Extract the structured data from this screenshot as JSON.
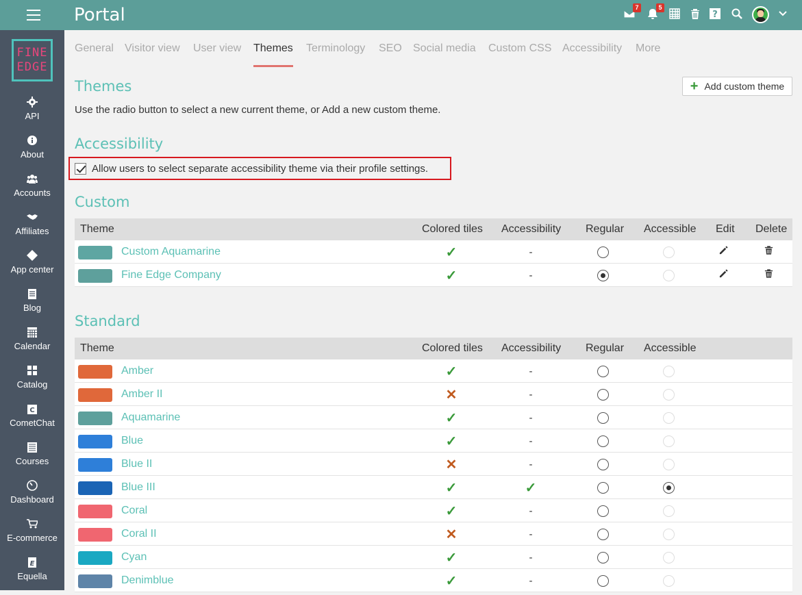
{
  "app": {
    "title": "Portal"
  },
  "topbar": {
    "mail_badge": "7",
    "notifications_badge": "5",
    "icons": [
      "hamburger-icon",
      "mail-icon",
      "bell-icon",
      "calendar-grid-icon",
      "trash-icon",
      "help-icon",
      "search-icon",
      "avatar",
      "chevron-down-icon"
    ]
  },
  "sidebar": {
    "logo_top": "FINE",
    "logo_bottom": "EDGE",
    "items": [
      {
        "label": "API",
        "icon": "gear-icon"
      },
      {
        "label": "About",
        "icon": "info-icon"
      },
      {
        "label": "Accounts",
        "icon": "users-icon"
      },
      {
        "label": "Affiliates",
        "icon": "handshake-icon"
      },
      {
        "label": "App center",
        "icon": "diamonds-icon"
      },
      {
        "label": "Blog",
        "icon": "document-icon"
      },
      {
        "label": "Calendar",
        "icon": "calendar-icon"
      },
      {
        "label": "Catalog",
        "icon": "grid-icon"
      },
      {
        "label": "CometChat",
        "icon": "cometchat-icon"
      },
      {
        "label": "Courses",
        "icon": "courses-icon"
      },
      {
        "label": "Dashboard",
        "icon": "dashboard-icon"
      },
      {
        "label": "E-commerce",
        "icon": "cart-icon"
      },
      {
        "label": "Equella",
        "icon": "equella-icon"
      }
    ]
  },
  "tabs": [
    "General",
    "Visitor view",
    "User view",
    "Themes",
    "Terminology",
    "SEO",
    "Social media",
    "Custom CSS",
    "Accessibility",
    "More"
  ],
  "active_tab": "Themes",
  "themes_section": {
    "title": "Themes",
    "description": "Use the radio button to select a new current theme, or Add a new custom theme.",
    "add_button": "Add custom theme"
  },
  "accessibility_section": {
    "title": "Accessibility",
    "checkbox_label": "Allow users to select separate accessibility theme via their profile settings.",
    "checked": true
  },
  "custom_section": {
    "title": "Custom",
    "headers": {
      "theme": "Theme",
      "tiles": "Colored tiles",
      "accessibility": "Accessibility",
      "regular": "Regular",
      "accessible": "Accessible",
      "edit": "Edit",
      "delete": "Delete"
    },
    "rows": [
      {
        "name": "Custom Aquamarine",
        "color": "#5ea6a2",
        "tiles": "check",
        "acc": "-",
        "regular": false,
        "accessible": false
      },
      {
        "name": "Fine Edge Company",
        "color": "#5ea09c",
        "tiles": "check",
        "acc": "-",
        "regular": true,
        "accessible": false
      }
    ]
  },
  "standard_section": {
    "title": "Standard",
    "headers": {
      "theme": "Theme",
      "tiles": "Colored tiles",
      "accessibility": "Accessibility",
      "regular": "Regular",
      "accessible": "Accessible"
    },
    "rows": [
      {
        "name": "Amber",
        "color": "#e0683a",
        "tiles": "check",
        "acc": "-",
        "regular": false,
        "accessible": false
      },
      {
        "name": "Amber II",
        "color": "#e0683a",
        "tiles": "cross",
        "acc": "-",
        "regular": false,
        "accessible": false
      },
      {
        "name": "Aquamarine",
        "color": "#5ea09c",
        "tiles": "check",
        "acc": "-",
        "regular": false,
        "accessible": false
      },
      {
        "name": "Blue",
        "color": "#2e7fd9",
        "tiles": "check",
        "acc": "-",
        "regular": false,
        "accessible": false
      },
      {
        "name": "Blue II",
        "color": "#2e7fd9",
        "tiles": "cross",
        "acc": "-",
        "regular": false,
        "accessible": false
      },
      {
        "name": "Blue III",
        "color": "#1a64b5",
        "tiles": "check",
        "acc": "check",
        "regular": false,
        "accessible": true
      },
      {
        "name": "Coral",
        "color": "#f06670",
        "tiles": "check",
        "acc": "-",
        "regular": false,
        "accessible": false
      },
      {
        "name": "Coral II",
        "color": "#f06670",
        "tiles": "cross",
        "acc": "-",
        "regular": false,
        "accessible": false
      },
      {
        "name": "Cyan",
        "color": "#1aa8c2",
        "tiles": "check",
        "acc": "-",
        "regular": false,
        "accessible": false
      },
      {
        "name": "Denimblue",
        "color": "#5e84a8",
        "tiles": "check",
        "acc": "-",
        "regular": false,
        "accessible": false
      }
    ]
  },
  "colors": {
    "topbar": "#5c9e99",
    "sidebar": "#4a5563",
    "accent": "#5cc0b5",
    "tab_underline": "#e0736e",
    "highlight_border": "#d7191f",
    "check": "#3a9a3a",
    "cross": "#c05a1e"
  }
}
